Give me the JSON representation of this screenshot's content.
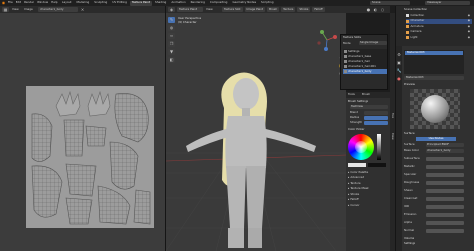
{
  "top_menu": [
    "File",
    "Edit",
    "Render",
    "Window",
    "Help"
  ],
  "workspace_tabs": [
    "Layout",
    "Modeling",
    "Sculpting",
    "UV Editing",
    "Texture Paint",
    "Shading",
    "Animation",
    "Rendering",
    "Compositing",
    "Geometry Nodes",
    "Scripting"
  ],
  "scene_label": "Scene",
  "view_layer_label": "ViewLayer",
  "image_editor": {
    "menus": [
      "View",
      "Image"
    ],
    "image_name": "character1_body"
  },
  "viewport": {
    "mode": "Texture Paint",
    "menus": [
      "View"
    ],
    "info_line1": "User Perspective",
    "info_line2": "(9) Character",
    "header_items": [
      "Texture Slot",
      "Image Paint",
      "Brush",
      "Texture",
      "Stroke",
      "Falloff"
    ],
    "n_tabs": [
      "Tool",
      "View"
    ]
  },
  "texture_popup": {
    "title": "Texture Slots",
    "mode_label": "Mode",
    "mode_value": "Single Image",
    "items": [
      "Settings",
      "character1_base",
      "character1_hair",
      "character1_hair.001",
      "character1_body"
    ],
    "selected_index": 4
  },
  "tool_panel": {
    "tabs": [
      "Tools",
      "Brush"
    ],
    "brush_settings": "Brush Settings",
    "brush_name": "TexDraw",
    "rows": [
      "Blend",
      "Radius",
      "Strength",
      "Mix"
    ],
    "color_picker": "Color Picker",
    "sections": [
      "Color Palette",
      "Advanced",
      "Texture",
      "Texture Mask",
      "Stroke",
      "Falloff",
      "Cursor"
    ]
  },
  "outliner": {
    "title": "Scene Collection",
    "items": [
      "Collection",
      "Character",
      "Armature",
      "Camera",
      "Light"
    ]
  },
  "properties": {
    "material_name": "Material.003",
    "sections": [
      "Preview",
      "Surface",
      "Volume",
      "Settings"
    ],
    "surface_label": "Use Nodes",
    "surface_shader": "Principled BSDF",
    "base_color": "character1_body",
    "rows": [
      "Surface",
      "Base Color",
      "Subsurface",
      "Metallic",
      "Specular",
      "Roughness",
      "Sheen",
      "Clearcoat",
      "IOR",
      "Emission",
      "Alpha",
      "Normal"
    ]
  },
  "colors": {
    "accent": "#4772b3",
    "panel_bg": "#303030",
    "viewport_bg": "#3a3a3a",
    "header_bg": "#2b2b2b",
    "character": "#bdbdbd",
    "hair": "#e6deaa"
  }
}
